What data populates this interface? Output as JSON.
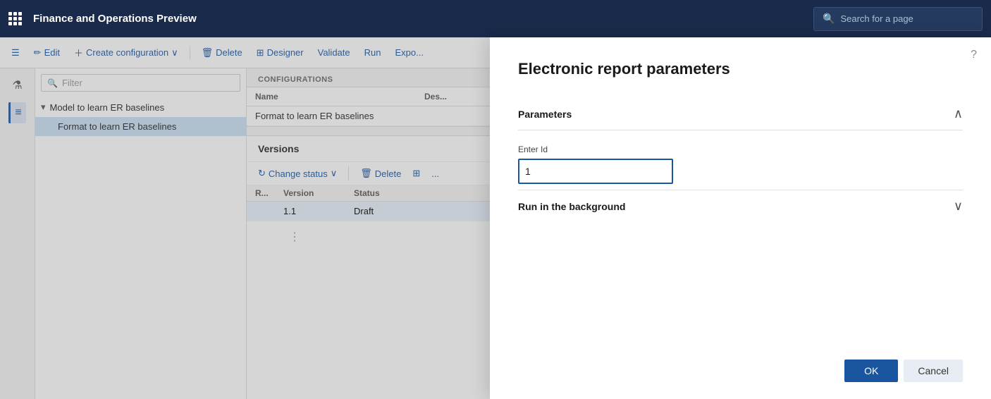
{
  "topnav": {
    "title": "Finance and Operations Preview",
    "search_placeholder": "Search for a page"
  },
  "toolbar": {
    "edit_label": "Edit",
    "create_label": "Create configuration",
    "delete_label": "Delete",
    "designer_label": "Designer",
    "validate_label": "Validate",
    "run_label": "Run",
    "export_label": "Expo..."
  },
  "filter": {
    "placeholder": "Filter"
  },
  "tree": {
    "parent_label": "Model to learn ER baselines",
    "child_label": "Format to learn ER baselines"
  },
  "configurations": {
    "section_label": "CONFIGURATIONS",
    "col_name": "Name",
    "col_desc": "Des...",
    "row_name": "Format to learn ER baselines"
  },
  "versions": {
    "title": "Versions",
    "change_status_label": "Change status",
    "delete_label": "Delete",
    "col_r": "R...",
    "col_version": "Version",
    "col_status": "Status",
    "row_version": "1.1",
    "row_status": "Draft"
  },
  "modal": {
    "title": "Electronic report parameters",
    "help_icon": "?",
    "parameters_section": "Parameters",
    "enter_id_label": "Enter Id",
    "enter_id_value": "1",
    "run_background_section": "Run in the background",
    "ok_label": "OK",
    "cancel_label": "Cancel"
  }
}
